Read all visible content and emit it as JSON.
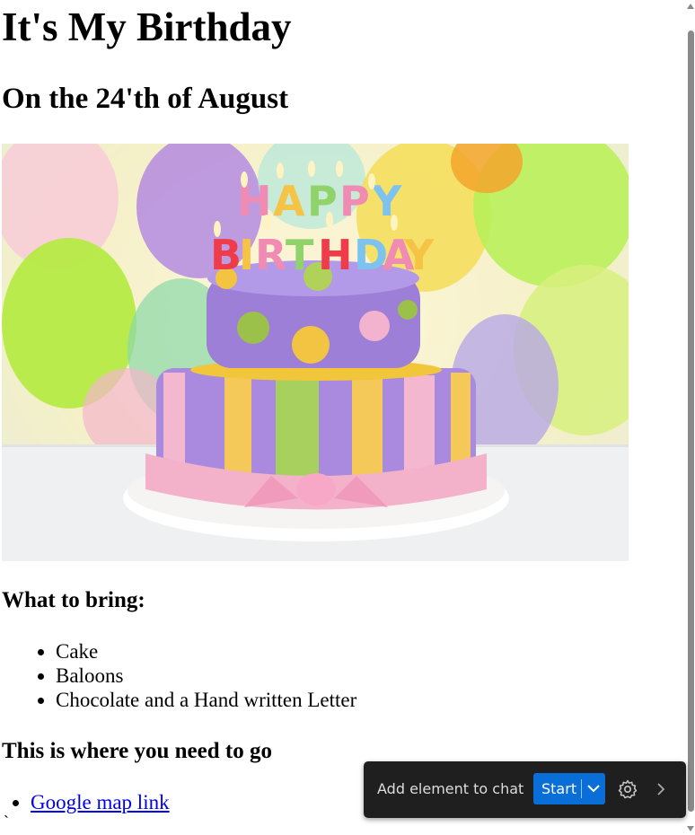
{
  "page": {
    "title": "It's My Birthday",
    "subtitle": "On the 24'th of August",
    "image_alt": "Birthday cake with Happy Birthday candles",
    "image_text": "HAPPY BIRTHDAY",
    "bring_heading": "What to bring:",
    "bring_items": [
      "Cake",
      "Baloons",
      "Chocolate and a Hand written Letter"
    ],
    "go_heading": "This is where you need to go",
    "map_link": "Google map link",
    "stray_char": "`"
  },
  "chatbar": {
    "label": "Add element to chat",
    "start_label": "Start",
    "icons": [
      "chevron-down-icon",
      "gear-icon",
      "chevron-right-icon"
    ]
  },
  "colors": {
    "link": "#0000ee",
    "chatbar_bg": "#1f1f1f",
    "start_button": "#0a6ed8"
  }
}
